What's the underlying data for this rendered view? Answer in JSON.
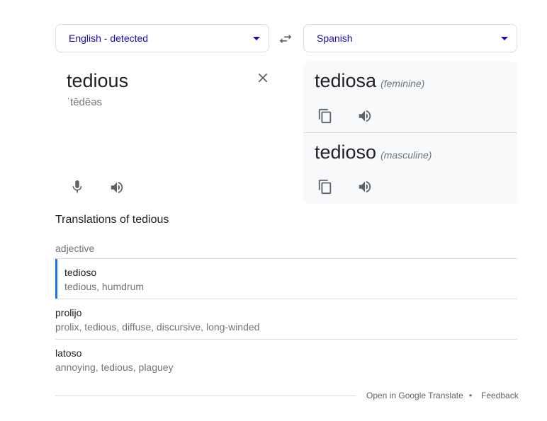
{
  "source": {
    "language_label": "English - detected",
    "word": "tedious",
    "phonetic": "ˈtēdēəs"
  },
  "target": {
    "language_label": "Spanish",
    "results": [
      {
        "word": "tediosa",
        "gender": "(feminine)"
      },
      {
        "word": "tedioso",
        "gender": "(masculine)"
      }
    ]
  },
  "icons": {
    "swap": "swap-languages-icon",
    "clear": "close-icon",
    "mic": "microphone-icon",
    "speaker": "speaker-icon",
    "copy": "copy-icon",
    "dropdown": "chevron-down-icon"
  },
  "translations": {
    "title": "Translations of tedious",
    "part_of_speech": "adjective",
    "items": [
      {
        "word": "tedioso",
        "synonyms": "tedious, humdrum",
        "active": true
      },
      {
        "word": "prolijo",
        "synonyms": "prolix, tedious, diffuse, discursive, long-winded",
        "active": false
      },
      {
        "word": "latoso",
        "synonyms": "annoying, tedious, plaguey",
        "active": false
      }
    ]
  },
  "footer": {
    "open_link": "Open in Google Translate",
    "separator": "•",
    "feedback_link": "Feedback"
  },
  "colors": {
    "link": "#1a0dab",
    "accent": "#1a73e8",
    "panel_bg": "#f8f9fa",
    "icon": "#5f6368"
  }
}
